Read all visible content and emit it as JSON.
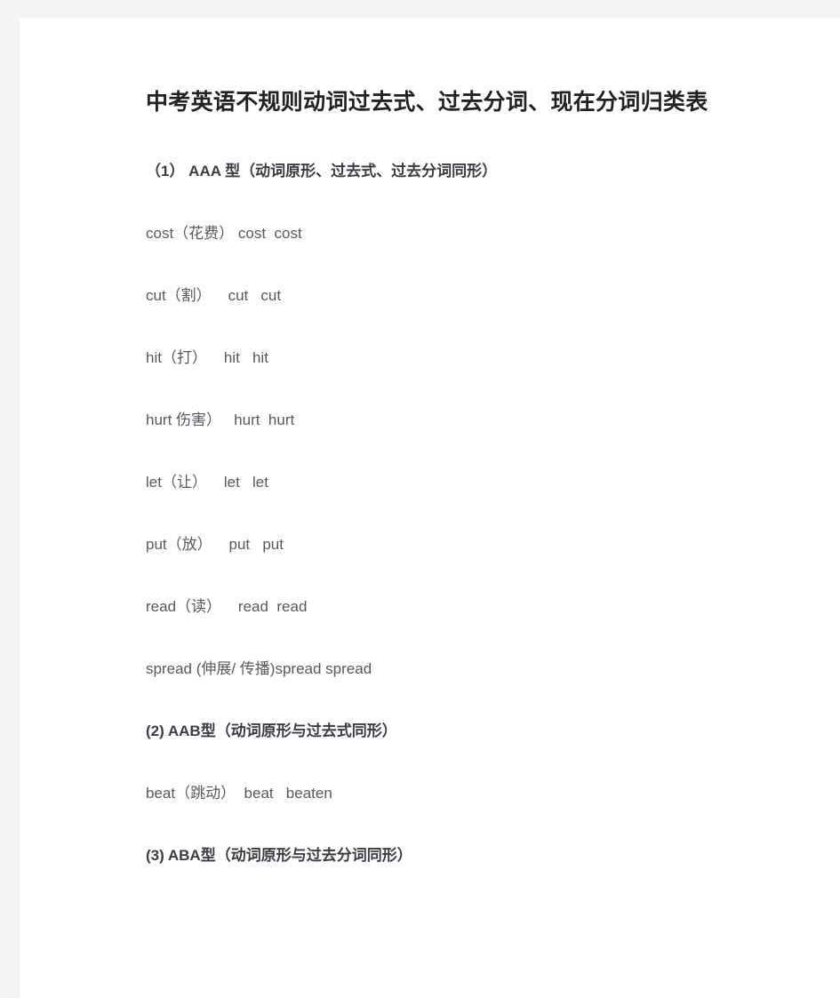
{
  "document": {
    "title": "中考英语不规则动词过去式、过去分词、现在分词归类表",
    "sections": [
      {
        "heading": "（1） AAA 型（动词原形、过去式、过去分词同形）",
        "rows": [
          "cost（花费） cost  cost",
          "cut（割）    cut   cut",
          "hit（打）    hit   hit",
          "hurt 伤害）   hurt  hurt",
          "let（让）    let   let",
          "put（放）    put   put",
          "read（读）    read  read",
          "spread (伸展/ 传播)spread spread"
        ]
      },
      {
        "heading": "(2) AAB型（动词原形与过去式同形）",
        "rows": [
          "beat（跳动）  beat   beaten"
        ]
      },
      {
        "heading": "(3) ABA型（动词原形与过去分词同形）",
        "rows": []
      }
    ]
  }
}
